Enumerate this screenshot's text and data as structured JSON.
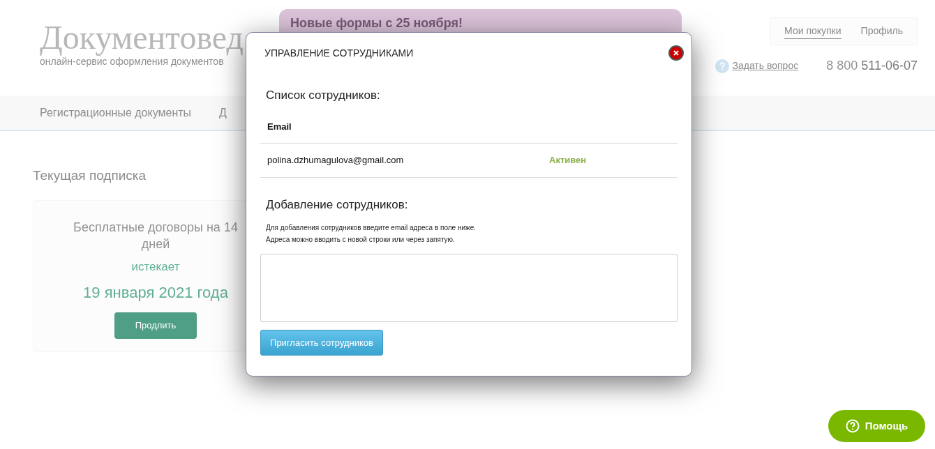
{
  "site": {
    "logo": "Документовед",
    "tagline": "онлайн-сервис оформления документов",
    "banner": "Новые формы с 25 ноября!",
    "account_links": [
      {
        "label": "Мои покупки",
        "selected": true
      },
      {
        "label": "Профиль",
        "selected": false
      }
    ],
    "ask_link": "Задать вопрос",
    "phone_prefix": "8 800",
    "phone_number": "511-06-07",
    "nav": [
      "Регистрационные документы",
      "Д"
    ]
  },
  "subscription": {
    "heading": "Текущая подписка",
    "plan": "Бесплатные договоры на 14 дней",
    "expires_label": "истекает",
    "expires_date": "19 января 2021 года",
    "button": "Продлить"
  },
  "modal": {
    "title": "УПРАВЛЕНИЕ СОТРУДНИКАМИ",
    "list_heading": "Список сотрудников:",
    "columns": [
      "Email"
    ],
    "rows": [
      {
        "email": "polina.dzhumagulova@gmail.com",
        "status": "Активен",
        "color": "#8ab04a"
      }
    ],
    "add_heading": "Добавление сотрудников:",
    "hint_lines": [
      "Для добавления сотрудников введите email адреса в поле ниже.",
      "Адреса можно вводить с новой строки или через запятую."
    ],
    "invite_button": "Пригласить сотрудников"
  },
  "help_button": "Помощь"
}
